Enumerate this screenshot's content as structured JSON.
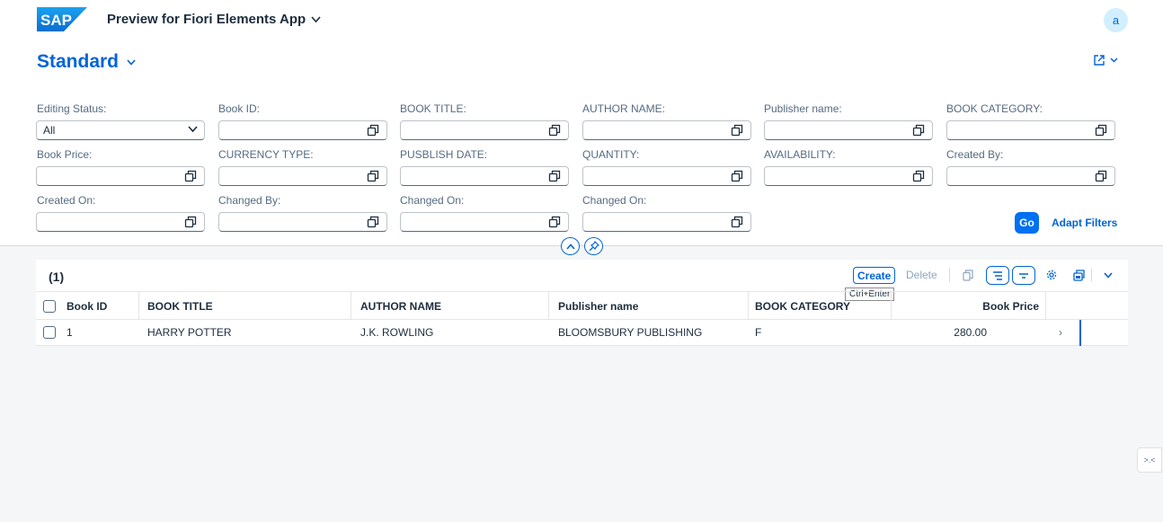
{
  "shell": {
    "logo_text": "SAP",
    "app_title": "Preview for Fiori Elements App",
    "avatar_initial": "a"
  },
  "header": {
    "variant_name": "Standard"
  },
  "filters": {
    "editing_status": {
      "label": "Editing Status:",
      "value": "All"
    },
    "book_id": "Book ID:",
    "book_title": "BOOK TITLE:",
    "author_name": "AUTHOR NAME:",
    "publisher_name": "Publisher name:",
    "book_category": "BOOK CATEGORY:",
    "book_price": "Book Price:",
    "currency_type": "CURRENCY TYPE:",
    "publish_date": "PUSBLISH DATE:",
    "quantity": "QUANTITY:",
    "availability": "AVAILABILITY:",
    "created_by": "Created By:",
    "created_on": "Created On:",
    "changed_by": "Changed By:",
    "changed_on_1": "Changed On:",
    "changed_on_2": "Changed On:",
    "go_label": "Go",
    "adapt_label": "Adapt Filters"
  },
  "table": {
    "count": "(1)",
    "create_label": "Create",
    "create_tooltip": "Ctrl+Enter",
    "delete_label": "Delete",
    "columns": [
      "Book ID",
      "BOOK TITLE",
      "AUTHOR NAME",
      "Publisher name",
      "BOOK CATEGORY",
      "Book Price"
    ],
    "rows": [
      {
        "book_id": "1",
        "book_title": "HARRY POTTER",
        "author_name": "J.K. ROWLING",
        "publisher": "BLOOMSBURY PUBLISHING",
        "category": "F",
        "price": "280.00"
      }
    ]
  },
  "colors": {
    "accent": "#0064d9",
    "go_button": "#0070f2",
    "logo": "#0a6ed1"
  }
}
